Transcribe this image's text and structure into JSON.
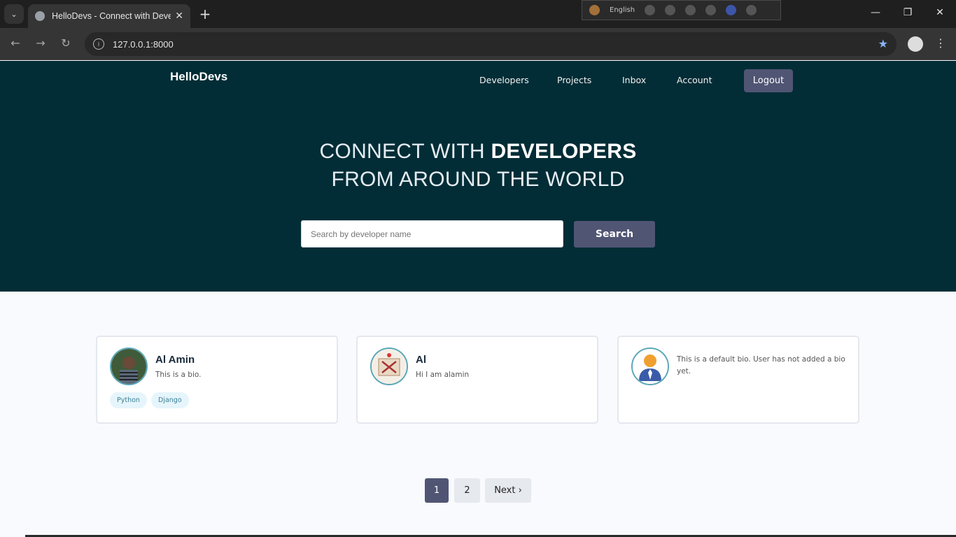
{
  "browser": {
    "tab_title": "HelloDevs - Connect with Developers",
    "url": "127.0.0.1:8000",
    "ime_language": "English"
  },
  "nav": {
    "brand": "HelloDevs",
    "links": [
      "Developers",
      "Projects",
      "Inbox",
      "Account"
    ],
    "logout": "Logout"
  },
  "hero": {
    "line1_light": "CONNECT WITH ",
    "line1_bold": "DEVELOPERS",
    "line2": "FROM AROUND THE WORLD",
    "search_placeholder": "Search by developer name",
    "search_button": "Search"
  },
  "developers": [
    {
      "name": "Al Amin",
      "bio": "This is a bio.",
      "tags": [
        "Python",
        "Django"
      ]
    },
    {
      "name": "Al",
      "bio": "Hi I am alamin",
      "tags": []
    },
    {
      "name": "",
      "bio": "This is a default bio. User has not added a bio yet.",
      "tags": []
    }
  ],
  "pagination": {
    "pages": [
      "1",
      "2"
    ],
    "active": "1",
    "next": "Next ›"
  },
  "colors": {
    "hero_bg": "#022d36",
    "accent": "#515574",
    "tag_bg": "#e5f5fb"
  }
}
